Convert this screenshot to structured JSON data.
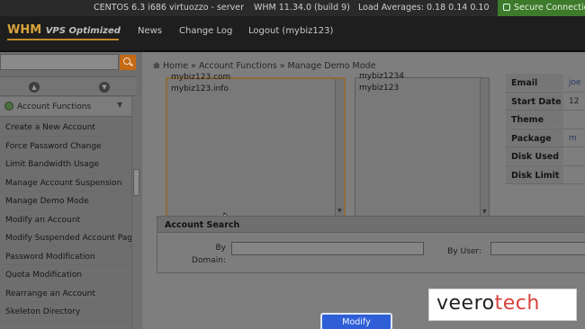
{
  "statusbar": {
    "os": "CENTOS 6.3 i686 virtuozzo - server",
    "whm": "WHM 11.34.0 (build 9)",
    "load": "Load Averages: 0.18 0.14 0.10",
    "secure": "Secure Connection"
  },
  "header": {
    "logo": "WHM",
    "logo_sub": "VPS Optimized",
    "nav": [
      "News",
      "Change Log",
      "Logout (mybiz123)"
    ]
  },
  "sidebar": {
    "search_placeholder": "",
    "category": "Account Functions",
    "items": [
      "Create a New Account",
      "Force Password Change",
      "Limit Bandwidth Usage",
      "Manage Account Suspension",
      "Manage Demo Mode",
      "Modify an Account",
      "Modify Suspended Account Page",
      "Password Modification",
      "Quota Modification",
      "Rearrange an Account",
      "Skeleton Directory"
    ]
  },
  "breadcrumb": {
    "home": "Home",
    "section": "Account Functions",
    "page": "Manage Demo Mode",
    "sep": "»"
  },
  "listboxes": {
    "domains": [
      "mybiz123.com",
      "mybiz123.info"
    ],
    "users": [
      "mybiz1234",
      "mybiz123"
    ]
  },
  "account_info": [
    {
      "key": "Email",
      "value": "joe"
    },
    {
      "key": "Start Date",
      "value": "12"
    },
    {
      "key": "Theme",
      "value": ""
    },
    {
      "key": "Package",
      "value": "m"
    },
    {
      "key": "Disk Used",
      "value": ""
    },
    {
      "key": "Disk Limit",
      "value": ""
    }
  ],
  "account_search": {
    "title": "Account Search",
    "by_domain_label_1": "By",
    "by_domain_label_2": "Domain:",
    "by_user_label": "By User:"
  },
  "modify_button": "Modify",
  "watermark": {
    "part1": "veero",
    "part2": "tech"
  }
}
